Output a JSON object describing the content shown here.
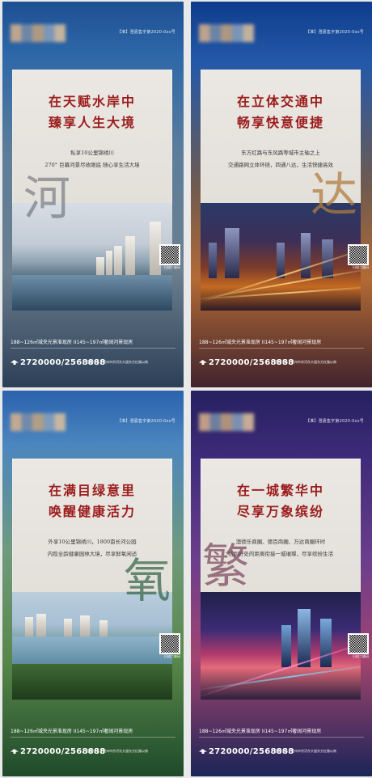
{
  "posters": [
    {
      "licence": "【准】澄嘉售字第2020-0xx号",
      "headline": [
        "在天赋水岸中",
        "臻享人生大境"
      ],
      "copy": [
        "私享10公里锦绣川",
        "270° 巨幕河景尽收眼底  随心享生活大境"
      ],
      "big_char": "河",
      "qr_caption": "扫描二维码",
      "specs": "188~126㎡城央光景准现房  II145~197㎡奢阔河景现房",
      "tel": "2720000/2568888",
      "addr": "营销中心：德州市京河东大道东方红路以南"
    },
    {
      "licence": "【准】澄嘉售字第2020-0xx号",
      "headline": [
        "在立体交通中",
        "畅享快意便捷"
      ],
      "copy": [
        "东方红路与东风路等城市主轴之上",
        "交通路网立体环绕，四通八达，生活快捷高效"
      ],
      "big_char": "达",
      "qr_caption": "扫描二维码",
      "specs": "188~126㎡城央光景准现房  II145~197㎡奢阔河景现房",
      "tel": "2720000/2568888",
      "addr": "营销中心：德州市京河东大道东方红路以南"
    },
    {
      "licence": "【准】澄嘉售字第2020-0xx号",
      "headline": [
        "在满目绿意里",
        "唤醒健康活力"
      ],
      "copy": [
        "外享10公里锦绣川，1800亩长河公园",
        "内揽全龄健康园林大境，尽享鲜氧闲适"
      ],
      "big_char": "氧",
      "qr_caption": "扫描二维码",
      "specs": "188~126㎡城央光景准现房  II145~197㎡奢阔河景现房",
      "tel": "2720000/2568888",
      "addr": "营销中心：德州市京河东大道东方红路以南"
    },
    {
      "licence": "【准】澄嘉售字第2020-0xx号",
      "headline": [
        "在一城繁华中",
        "尽享万象缤纷"
      ],
      "copy": [
        "澳德乐商圈、德百商圈、万达商圈环时",
        "恰到好处的距离衔接一城璀璨，尽享缤纷生活"
      ],
      "big_char": "繁",
      "qr_caption": "扫描二维码",
      "specs": "188~126㎡城央光景准现房  II145~197㎡奢阔河景现房",
      "tel": "2720000/2568888",
      "addr": "营销中心：德州市京河东大道东方红路以南"
    }
  ],
  "colors": {
    "headline": "#9b1c1c",
    "card": "#e6e2dc"
  }
}
